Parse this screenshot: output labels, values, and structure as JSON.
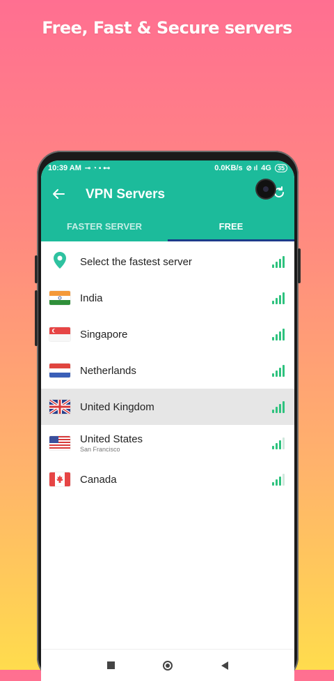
{
  "headline": "Free, Fast & Secure servers",
  "status_bar": {
    "time": "10:39 AM",
    "network_speed": "0.0KB/s",
    "network_type": "4G",
    "battery": "35"
  },
  "app_bar": {
    "title": "VPN Servers",
    "back_icon": "arrow-left-icon",
    "refresh_icon": "refresh-icon"
  },
  "tabs": [
    {
      "label": "FASTER SERVER",
      "active": false
    },
    {
      "label": "FREE",
      "active": true
    }
  ],
  "servers": [
    {
      "name": "Select the fastest server",
      "icon": "location-pin-icon",
      "signal": 4
    },
    {
      "name": "India",
      "icon": "india-flag-icon",
      "signal": 4
    },
    {
      "name": "Singapore",
      "icon": "singapore-flag-icon",
      "signal": 4
    },
    {
      "name": "Netherlands",
      "icon": "netherlands-flag-icon",
      "signal": 4
    },
    {
      "name": "United Kingdom",
      "icon": "uk-flag-icon",
      "signal": 4,
      "selected": true
    },
    {
      "name": "United States",
      "sub": "San Francisco",
      "icon": "usa-flag-icon",
      "signal": 3
    },
    {
      "name": "Canada",
      "icon": "canada-flag-icon",
      "signal": 3
    }
  ],
  "colors": {
    "primary": "#1cbb9b",
    "tab_indicator": "#1b3b8a",
    "signal": "#2ec27e"
  }
}
